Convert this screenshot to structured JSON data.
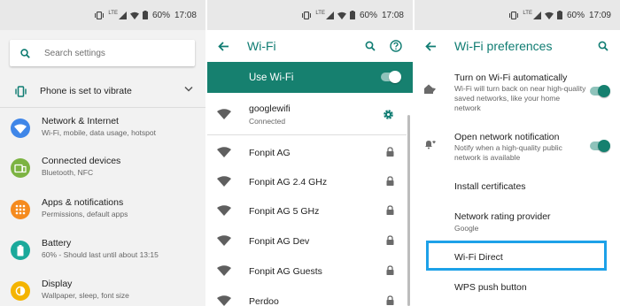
{
  "status_bar": {
    "battery_left": "60%",
    "time_left": "17:08",
    "battery_mid": "60%",
    "time_mid": "17:08",
    "battery_right": "60%",
    "time_right": "17:09",
    "network_type": "LTE"
  },
  "settings_screen": {
    "search_placeholder": "Search settings",
    "vibrate_label": "Phone is set to vibrate",
    "items": [
      {
        "title": "Network & Internet",
        "subtitle": "Wi-Fi, mobile, data usage, hotspot",
        "icon": "wifi-icon",
        "color": "#3f86e8"
      },
      {
        "title": "Connected devices",
        "subtitle": "Bluetooth, NFC",
        "icon": "devices-icon",
        "color": "#7cb342"
      },
      {
        "title": "Apps & notifications",
        "subtitle": "Permissions, default apps",
        "icon": "apps-icon",
        "color": "#f58b1f"
      },
      {
        "title": "Battery",
        "subtitle": "60% - Should last until about 13:15",
        "icon": "battery-icon",
        "color": "#1aa99b"
      },
      {
        "title": "Display",
        "subtitle": "Wallpaper, sleep, font size",
        "icon": "display-icon",
        "color": "#f4b400"
      }
    ]
  },
  "wifi_screen": {
    "title": "Wi-Fi",
    "use_wifi_label": "Use Wi-Fi",
    "use_wifi_on": true,
    "connected_network": {
      "name": "googlewifi",
      "status": "Connected"
    },
    "networks": [
      "Fonpit AG",
      "Fonpit AG 2.4 GHz",
      "Fonpit AG 5 GHz",
      "Fonpit AG Dev",
      "Fonpit AG Guests",
      "Perdoo"
    ],
    "accent": "#16806f"
  },
  "prefs_screen": {
    "title": "Wi-Fi preferences",
    "items": [
      {
        "title": "Turn on Wi-Fi automatically",
        "subtitle": "Wi-Fi will turn back on near high-quality saved networks, like your home network",
        "toggle": true
      },
      {
        "title": "Open network notification",
        "subtitle": "Notify when a high-quality public network is available",
        "toggle": true
      },
      {
        "title": "Install certificates",
        "subtitle": ""
      },
      {
        "title": "Network rating provider",
        "subtitle": "Google"
      },
      {
        "title": "Wi-Fi Direct",
        "subtitle": "",
        "highlighted": true
      },
      {
        "title": "WPS push button",
        "subtitle": ""
      }
    ],
    "highlight_color": "#1da1e8"
  }
}
